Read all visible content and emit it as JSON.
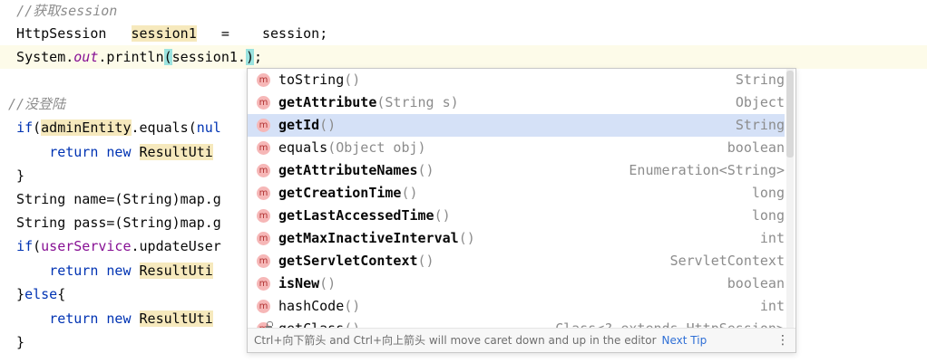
{
  "editor": {
    "lines": [
      [
        {
          "text": "  ",
          "cls": ""
        },
        {
          "text": "//获取session",
          "cls": "comment"
        }
      ],
      [
        {
          "text": "  HttpSession   ",
          "cls": ""
        },
        {
          "text": "session1",
          "cls": "hl-yellow"
        },
        {
          "text": "   =    session;",
          "cls": ""
        }
      ],
      [
        {
          "text": "  System.",
          "cls": ""
        },
        {
          "text": "out",
          "cls": "italic-field"
        },
        {
          "text": ".println",
          "cls": ""
        },
        {
          "text": "(",
          "cls": "hl-teal"
        },
        {
          "text": "session1.",
          "cls": ""
        },
        {
          "caret": true
        },
        {
          "text": ")",
          "cls": "hl-teal"
        },
        {
          "text": ";",
          "cls": ""
        }
      ],
      [
        {
          "text": "",
          "cls": ""
        }
      ],
      [
        {
          "text": " ",
          "cls": ""
        },
        {
          "text": "//没登陆",
          "cls": "comment"
        }
      ],
      [
        {
          "text": "  ",
          "cls": ""
        },
        {
          "text": "if",
          "cls": "kw"
        },
        {
          "text": "(",
          "cls": ""
        },
        {
          "text": "adminEntity",
          "cls": "hl-yellow"
        },
        {
          "text": ".equals(",
          "cls": ""
        },
        {
          "text": "nul",
          "cls": "kw"
        }
      ],
      [
        {
          "text": "      ",
          "cls": ""
        },
        {
          "text": "return new ",
          "cls": "kw"
        },
        {
          "text": "ResultUti",
          "cls": "hl-yellow"
        }
      ],
      [
        {
          "text": "  }",
          "cls": ""
        }
      ],
      [
        {
          "text": "  String name=(String)map.g",
          "cls": ""
        }
      ],
      [
        {
          "text": "  String pass=(String)map.g",
          "cls": ""
        }
      ],
      [
        {
          "text": "  ",
          "cls": ""
        },
        {
          "text": "if",
          "cls": "kw"
        },
        {
          "text": "(",
          "cls": ""
        },
        {
          "text": "userService",
          "cls": "field"
        },
        {
          "text": ".updateUser",
          "cls": ""
        }
      ],
      [
        {
          "text": "      ",
          "cls": ""
        },
        {
          "text": "return new ",
          "cls": "kw"
        },
        {
          "text": "ResultUti",
          "cls": "hl-yellow"
        }
      ],
      [
        {
          "text": "  }",
          "cls": ""
        },
        {
          "text": "else",
          "cls": "kw"
        },
        {
          "text": "{",
          "cls": ""
        }
      ],
      [
        {
          "text": "      ",
          "cls": ""
        },
        {
          "text": "return new ",
          "cls": "kw"
        },
        {
          "text": "ResultUti",
          "cls": "hl-yellow"
        }
      ],
      [
        {
          "text": "  }",
          "cls": ""
        }
      ]
    ]
  },
  "completion": {
    "badge": "m",
    "items": [
      {
        "name": "toString",
        "params": "()",
        "type": "String",
        "bold": false,
        "locked": false,
        "selected": false
      },
      {
        "name": "getAttribute",
        "params": "(String s)",
        "type": "Object",
        "bold": true,
        "locked": false,
        "selected": false
      },
      {
        "name": "getId",
        "params": "()",
        "type": "String",
        "bold": true,
        "locked": false,
        "selected": true
      },
      {
        "name": "equals",
        "params": "(Object obj)",
        "type": "boolean",
        "bold": false,
        "locked": false,
        "selected": false
      },
      {
        "name": "getAttributeNames",
        "params": "()",
        "type": "Enumeration<String>",
        "bold": true,
        "locked": false,
        "selected": false
      },
      {
        "name": "getCreationTime",
        "params": "()",
        "type": "long",
        "bold": true,
        "locked": false,
        "selected": false
      },
      {
        "name": "getLastAccessedTime",
        "params": "()",
        "type": "long",
        "bold": true,
        "locked": false,
        "selected": false
      },
      {
        "name": "getMaxInactiveInterval",
        "params": "()",
        "type": "int",
        "bold": true,
        "locked": false,
        "selected": false
      },
      {
        "name": "getServletContext",
        "params": "()",
        "type": "ServletContext",
        "bold": true,
        "locked": false,
        "selected": false
      },
      {
        "name": "isNew",
        "params": "()",
        "type": "boolean",
        "bold": true,
        "locked": false,
        "selected": false
      },
      {
        "name": "hashCode",
        "params": "()",
        "type": "int",
        "bold": false,
        "locked": false,
        "selected": false
      },
      {
        "name": "getClass",
        "params": "()",
        "type": "Class<? extends HttpSession>",
        "bold": false,
        "locked": true,
        "selected": false
      }
    ],
    "footer": {
      "hint": "Ctrl+向下箭头 and Ctrl+向上箭头 will move caret down and up in the editor",
      "link": "Next Tip",
      "menu": "⋮"
    }
  }
}
